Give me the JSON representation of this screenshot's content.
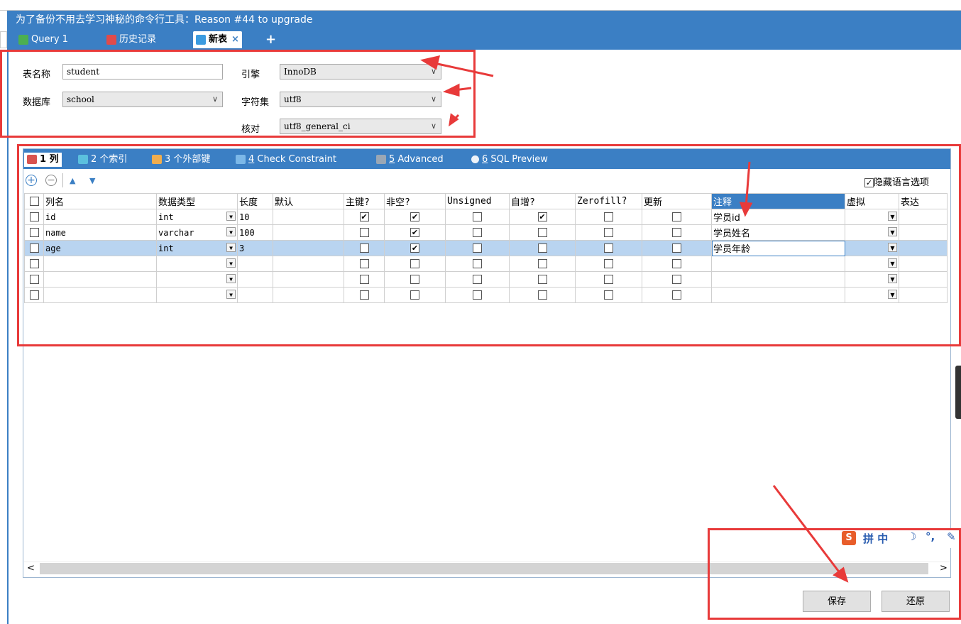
{
  "header": {
    "title": "为了备份不用去学习神秘的命令行工具：Reason #44 to upgrade",
    "tabs": [
      {
        "label": "Query 1"
      },
      {
        "label": "历史记录"
      },
      {
        "label": "新表"
      }
    ],
    "close_glyph": "×",
    "add_glyph": "+"
  },
  "form": {
    "table_name_label": "表名称",
    "table_name_value": "student",
    "database_label": "数据库",
    "database_value": "school",
    "engine_label": "引擎",
    "engine_value": "InnoDB",
    "charset_label": "字符集",
    "charset_value": "utf8",
    "collation_label": "核对",
    "collation_value": "utf8_general_ci"
  },
  "subtabs": [
    {
      "num": "1",
      "label": "列"
    },
    {
      "num": "2",
      "label": "个索引"
    },
    {
      "num": "3",
      "label": "个外部键"
    },
    {
      "num": "4",
      "label": "Check Constraint"
    },
    {
      "num": "5",
      "label": "Advanced"
    },
    {
      "num": "6",
      "label": "SQL Preview"
    }
  ],
  "toolbar": {
    "hide_lang_label": "隐藏语言选项"
  },
  "grid": {
    "headers": [
      "列名",
      "数据类型",
      "长度",
      "默认",
      "主键?",
      "非空?",
      "Unsigned",
      "自增?",
      "Zerofill?",
      "更新",
      "注释",
      "虚拟",
      "表达"
    ],
    "rows": [
      {
        "name": "id",
        "type": "int",
        "length": "10",
        "pk": true,
        "notnull": true,
        "unsigned": false,
        "ai": true,
        "zerofill": false,
        "update": false,
        "comment": "学员id"
      },
      {
        "name": "name",
        "type": "varchar",
        "length": "100",
        "pk": false,
        "notnull": true,
        "unsigned": false,
        "ai": false,
        "zerofill": false,
        "update": false,
        "comment": "学员姓名"
      },
      {
        "name": "age",
        "type": "int",
        "length": "3",
        "pk": false,
        "notnull": true,
        "unsigned": false,
        "ai": false,
        "zerofill": false,
        "update": false,
        "comment": "学员年龄"
      },
      {
        "name": "",
        "type": "",
        "length": "",
        "pk": false,
        "notnull": false,
        "unsigned": false,
        "ai": false,
        "zerofill": false,
        "update": false,
        "comment": ""
      },
      {
        "name": "",
        "type": "",
        "length": "",
        "pk": false,
        "notnull": false,
        "unsigned": false,
        "ai": false,
        "zerofill": false,
        "update": false,
        "comment": ""
      },
      {
        "name": "",
        "type": "",
        "length": "",
        "pk": false,
        "notnull": false,
        "unsigned": false,
        "ai": false,
        "zerofill": false,
        "update": false,
        "comment": ""
      }
    ]
  },
  "ime": {
    "label": "拼 中"
  },
  "buttons": {
    "save": "保存",
    "revert": "还原"
  },
  "colors": {
    "accent": "#3b7fc4",
    "annotation": "#e83a3a",
    "selected_row": "#b9d4f0"
  }
}
